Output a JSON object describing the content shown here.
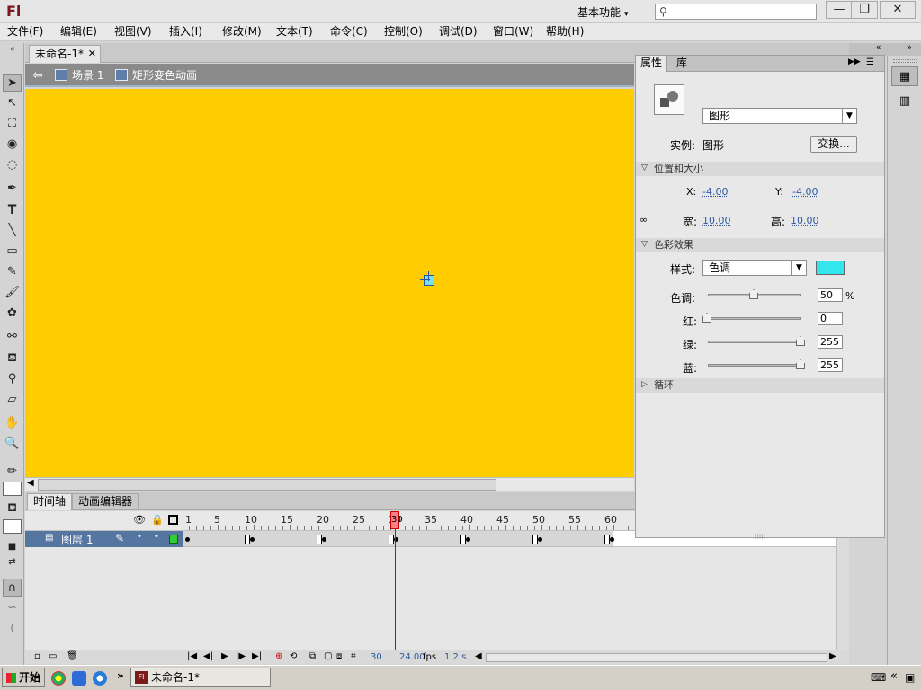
{
  "app": {
    "logo": "Fl",
    "workspace": "基本功能",
    "search_placeholder": ""
  },
  "window_controls": {
    "minimize": "—",
    "restore": "❐",
    "close": "✕"
  },
  "menu": [
    "文件(F)",
    "编辑(E)",
    "视图(V)",
    "插入(I)",
    "修改(M)",
    "文本(T)",
    "命令(C)",
    "控制(O)",
    "调试(D)",
    "窗口(W)",
    "帮助(H)"
  ],
  "document": {
    "tab": "未命名-1*",
    "scene": "场景 1",
    "symbol": "矩形变色动画"
  },
  "timeline": {
    "tabs": [
      "时间轴",
      "动画编辑器"
    ],
    "frame_numbers": [
      "1",
      "5",
      "10",
      "15",
      "20",
      "25",
      "30",
      "35",
      "40",
      "45",
      "50",
      "55",
      "60"
    ],
    "layer_name": "图层 1",
    "current_frame_label": "30",
    "status": {
      "frame": "30",
      "fps": "24.00",
      "fps_unit": "fps",
      "time": "1.2 s"
    },
    "current_frame": 30,
    "tween_end_frame": 60,
    "keyframes": [
      1,
      10,
      20,
      30,
      40,
      50,
      60
    ]
  },
  "properties": {
    "tabs": [
      "属性",
      "库"
    ],
    "type_select": "图形",
    "instance_label": "实例:",
    "instance_value": "图形",
    "swap_button": "交换...",
    "section_position": "位置和大小",
    "x_label": "X:",
    "x_value": "-4.00",
    "y_label": "Y:",
    "y_value": "-4.00",
    "w_label": "宽:",
    "w_value": "10.00",
    "h_label": "高:",
    "h_value": "10.00",
    "section_color": "色彩效果",
    "style_label": "样式:",
    "style_value": "色调",
    "tint_color": "#33e6ee",
    "tint_label": "色调:",
    "tint_value": "50",
    "tint_unit": "%",
    "red_label": "红:",
    "red_value": "0",
    "green_label": "绿:",
    "green_value": "255",
    "blue_label": "蓝:",
    "blue_value": "255",
    "section_loop": "循环"
  },
  "taskbar": {
    "start": "开始",
    "task": "未命名-1*",
    "chevron": "»"
  },
  "colors": {
    "stage": "#ffcc00",
    "layer_selected": "#5676a2",
    "playhead": "#e00000"
  }
}
